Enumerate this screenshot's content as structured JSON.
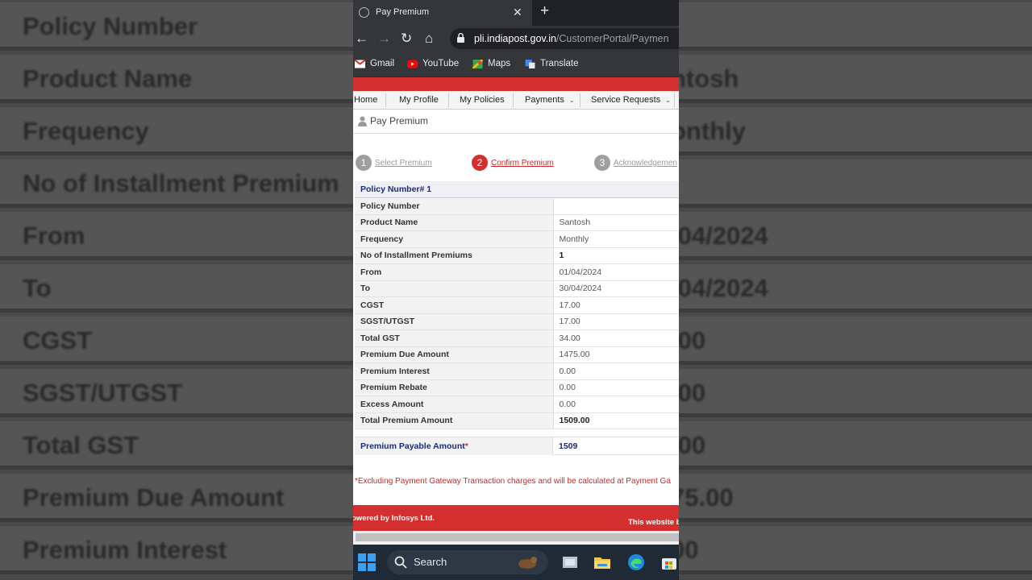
{
  "background": {
    "left_rows": [
      "Policy Number",
      "Product Name",
      "Frequency",
      "No of Installment Premium",
      "From",
      "To",
      "CGST",
      "SGST/UTGST",
      "Total GST",
      "Premium Due Amount",
      "Premium Interest"
    ],
    "right_rows": [
      "",
      "ntosh",
      "onthly",
      "",
      "/04/2024",
      "/04/2024",
      ".00",
      ".00",
      ".00",
      "75.00",
      "00"
    ]
  },
  "browser": {
    "tab_title": "Pay Premium",
    "url_host": "pli.indiapost.gov.in",
    "url_path": "/CustomerPortal/Paymen",
    "bookmarks": [
      "Gmail",
      "YouTube",
      "Maps",
      "Translate"
    ]
  },
  "nav": {
    "items": [
      "Home",
      "My Profile",
      "My Policies",
      "Payments",
      "Service Requests"
    ]
  },
  "page": {
    "heading": "Pay Premium",
    "steps": [
      {
        "num": "1",
        "label": "Select Premium"
      },
      {
        "num": "2",
        "label": "Confirm Premium"
      },
      {
        "num": "3",
        "label": "Acknowledgemen"
      }
    ],
    "table_header": "Policy Number# 1",
    "rows": [
      {
        "key": "Policy Number",
        "value": ""
      },
      {
        "key": "Product Name",
        "value": "Santosh"
      },
      {
        "key": "Frequency",
        "value": "Monthly"
      },
      {
        "key": "No of Installment Premiums",
        "value": "1"
      },
      {
        "key": "From",
        "value": "01/04/2024"
      },
      {
        "key": "To",
        "value": "30/04/2024"
      },
      {
        "key": "CGST",
        "value": "17.00"
      },
      {
        "key": "SGST/UTGST",
        "value": "17.00"
      },
      {
        "key": "Total GST",
        "value": "34.00"
      },
      {
        "key": "Premium Due Amount",
        "value": "1475.00"
      },
      {
        "key": "Premium Interest",
        "value": "0.00"
      },
      {
        "key": "Premium Rebate",
        "value": "0.00"
      },
      {
        "key": "Excess Amount",
        "value": "0.00"
      },
      {
        "key": "Total Premium Amount",
        "value": "1509.00"
      }
    ],
    "payable_label": "Premium Payable Amount",
    "payable_star": "*",
    "payable_value": "1509",
    "note": "*Excluding Payment Gateway Transaction charges and will be calculated at Payment Ga",
    "footer_left": "owered by Infosys Ltd.",
    "footer_right": "This website b"
  },
  "taskbar": {
    "search_label": "Search"
  },
  "colors": {
    "brand_red": "#d32f2f",
    "step_active": "#d32f2f",
    "step_inactive": "#9e9e9e",
    "header_text": "#1a2a7a"
  }
}
